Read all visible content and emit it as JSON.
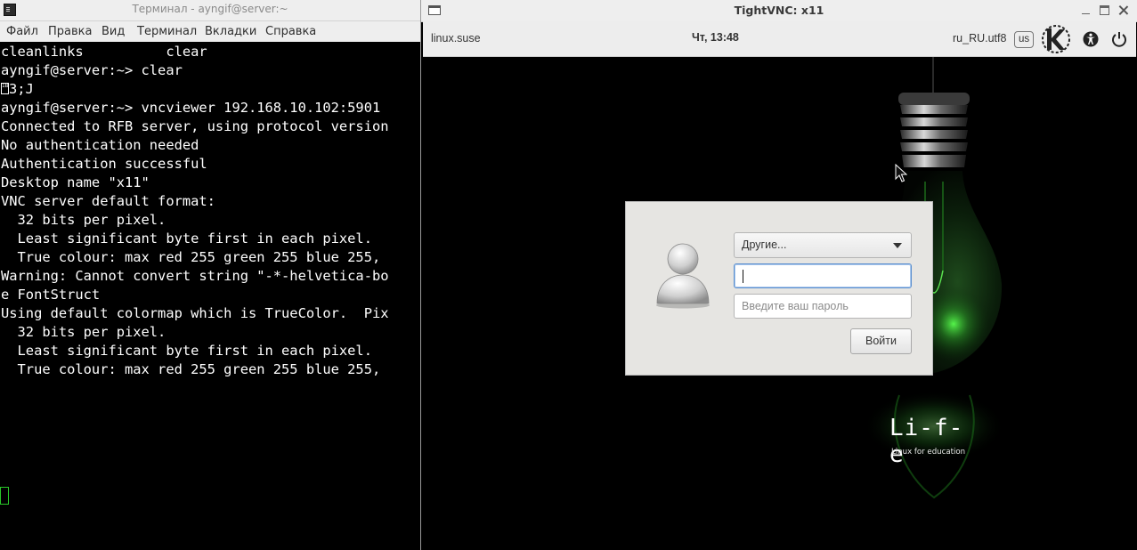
{
  "terminal": {
    "title": "Терминал - ayngif@server:~",
    "menu": [
      "Файл",
      "Правка",
      "Вид",
      "Терминал",
      "Вкладки",
      "Справка"
    ],
    "lines": [
      "cleanlinks          clear",
      "ayngif@server:~> clear",
      "3;J",
      "ayngif@server:~> vncviewer 192.168.10.102:5901",
      "Connected to RFB server, using protocol version",
      "No authentication needed",
      "Authentication successful",
      "Desktop name \"x11\"",
      "VNC server default format:",
      "  32 bits per pixel.",
      "  Least significant byte first in each pixel.",
      "  True colour: max red 255 green 255 blue 255,",
      "Warning: Cannot convert string \"-*-helvetica-bo",
      "e FontStruct",
      "Using default colormap which is TrueColor.  Pix",
      "  32 bits per pixel.",
      "  Least significant byte first in each pixel.",
      "  True colour: max red 255 green 255 blue 255,"
    ]
  },
  "vnc": {
    "title": "TightVNC: x11",
    "panel": {
      "hostname": "linux.suse",
      "clock": "Чт, 13:48",
      "locale": "ru_RU.utf8",
      "keyboard_layout": "us",
      "icons": [
        "kde-logo-icon",
        "accessibility-icon",
        "power-icon"
      ]
    },
    "login": {
      "user_select": "Другие...",
      "username_value": "",
      "password_placeholder": "Введите ваш пароль",
      "login_button": "Войти"
    },
    "branding": {
      "title": "Li-f-e",
      "subtitle": "Linux for education"
    }
  },
  "colors": {
    "terminal_bg": "#000000",
    "terminal_fg": "#ffffff",
    "cursor": "#29c729",
    "bulb_glow": "#39d43a",
    "input_focus": "#5b8fcf"
  }
}
